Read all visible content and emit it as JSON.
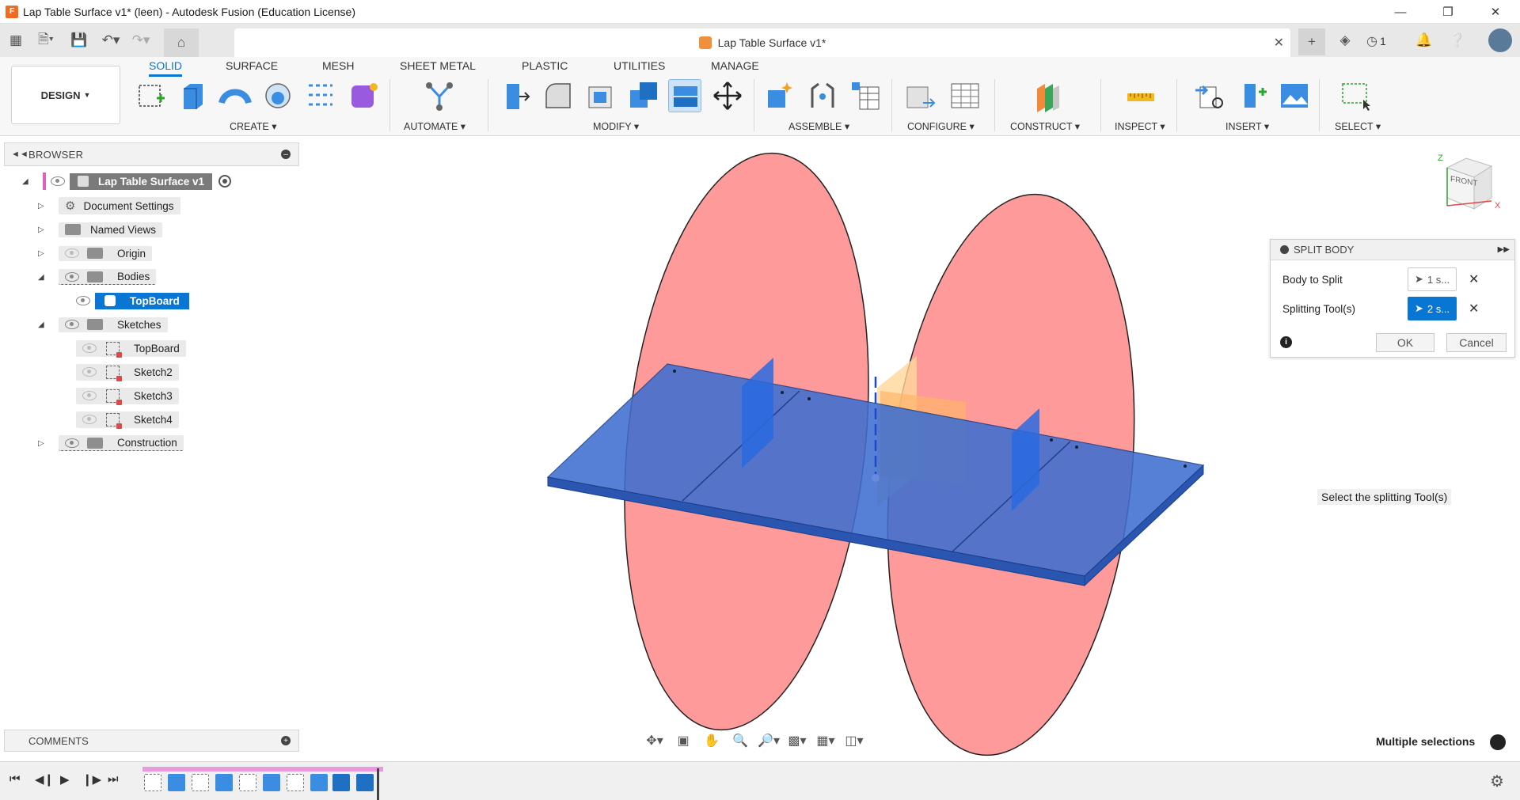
{
  "window": {
    "title": "Lap Table Surface v1* (leen) - Autodesk Fusion (Education License)",
    "app_icon_letter": "F",
    "controls": [
      "minimize-icon",
      "restore-icon",
      "close-icon"
    ]
  },
  "appbar": {
    "doc_tab_title": "Lap Table Surface v1*",
    "notification_count": "1"
  },
  "toolbar": {
    "workspace": "DESIGN",
    "tabs": [
      "SOLID",
      "SURFACE",
      "MESH",
      "SHEET METAL",
      "PLASTIC",
      "UTILITIES",
      "MANAGE"
    ],
    "active_tab": "SOLID",
    "groups": [
      "CREATE",
      "AUTOMATE",
      "MODIFY",
      "ASSEMBLE",
      "CONFIGURE",
      "CONSTRUCT",
      "INSPECT",
      "INSERT",
      "SELECT"
    ]
  },
  "browser": {
    "title": "BROWSER",
    "root": "Lap Table Surface v1",
    "items": [
      {
        "label": "Document Settings"
      },
      {
        "label": "Named Views"
      },
      {
        "label": "Origin"
      },
      {
        "label": "Bodies"
      },
      {
        "label": "TopBoard"
      },
      {
        "label": "Sketches"
      },
      {
        "label": "TopBoard"
      },
      {
        "label": "Sketch2"
      },
      {
        "label": "Sketch3"
      },
      {
        "label": "Sketch4"
      },
      {
        "label": "Construction"
      }
    ]
  },
  "split_body": {
    "title": "SPLIT BODY",
    "body_to_split_label": "Body to Split",
    "body_to_split_value": "1 s...",
    "splitting_tools_label": "Splitting Tool(s)",
    "splitting_tools_value": "2 s...",
    "ok": "OK",
    "cancel": "Cancel"
  },
  "viewcube": {
    "face": "FRONT",
    "axis_z": "Z",
    "axis_x": "X"
  },
  "hint": "Select the splitting Tool(s)",
  "comments": {
    "title": "COMMENTS"
  },
  "status": {
    "multiple_selections": "Multiple selections"
  },
  "colors": {
    "accent": "#0a76d4",
    "body_blue": "#3e6fd0",
    "plane_red": "#ff9a9a",
    "timeline_pink": "#e89ae0"
  }
}
